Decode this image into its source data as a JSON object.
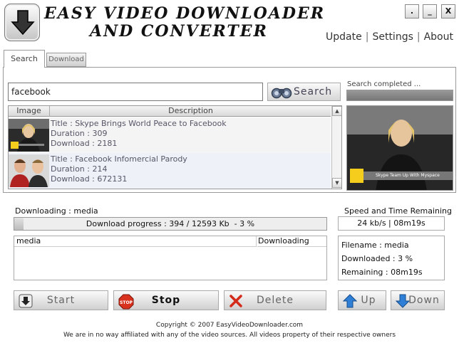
{
  "header": {
    "title_line1": "EASY VIDEO DOWNLOADER",
    "title_line2": "AND CONVERTER",
    "window_buttons": [
      ".",
      "_",
      "X"
    ],
    "nav": [
      "Update",
      "Settings",
      "About"
    ]
  },
  "tabs": [
    "Search",
    "Download"
  ],
  "search": {
    "value": "facebook",
    "button_label": "Search",
    "status": "Search completed ..."
  },
  "results": {
    "columns": [
      "Image",
      "Description"
    ],
    "rows": [
      {
        "title": "Title : Skype Brings World Peace to Facebook",
        "duration": "Duration : 309",
        "download": "Download : 2181"
      },
      {
        "title": "Title : Facebook Infomercial Parody",
        "duration": "Duration : 214",
        "download": "Download : 672131"
      }
    ]
  },
  "preview": {
    "caption": "Skype Team Up With Myspace"
  },
  "download": {
    "label": "Downloading : media",
    "progress_text": "Download progress : 394 / 12593 Kb  - 3 %",
    "progress_fraction": 0.03
  },
  "speed": {
    "title": "Speed and Time Remaining",
    "value": "24 kb/s | 08m19s"
  },
  "queue": {
    "columns": [
      "media",
      "Downloading"
    ]
  },
  "info": {
    "filename": "Filename : media",
    "downloaded": "Downloaded : 3 %",
    "remaining": "Remaining : 08m19s"
  },
  "buttons": {
    "start": "Start",
    "stop": "Stop",
    "delete": "Delete",
    "up": "Up",
    "down": "Down"
  },
  "footer": {
    "copyright": "Copyright © 2007 EasyVideoDownloader.com",
    "disclaimer": "We are in no way affiliated with any of the video sources. All videos property of their respective owners"
  }
}
